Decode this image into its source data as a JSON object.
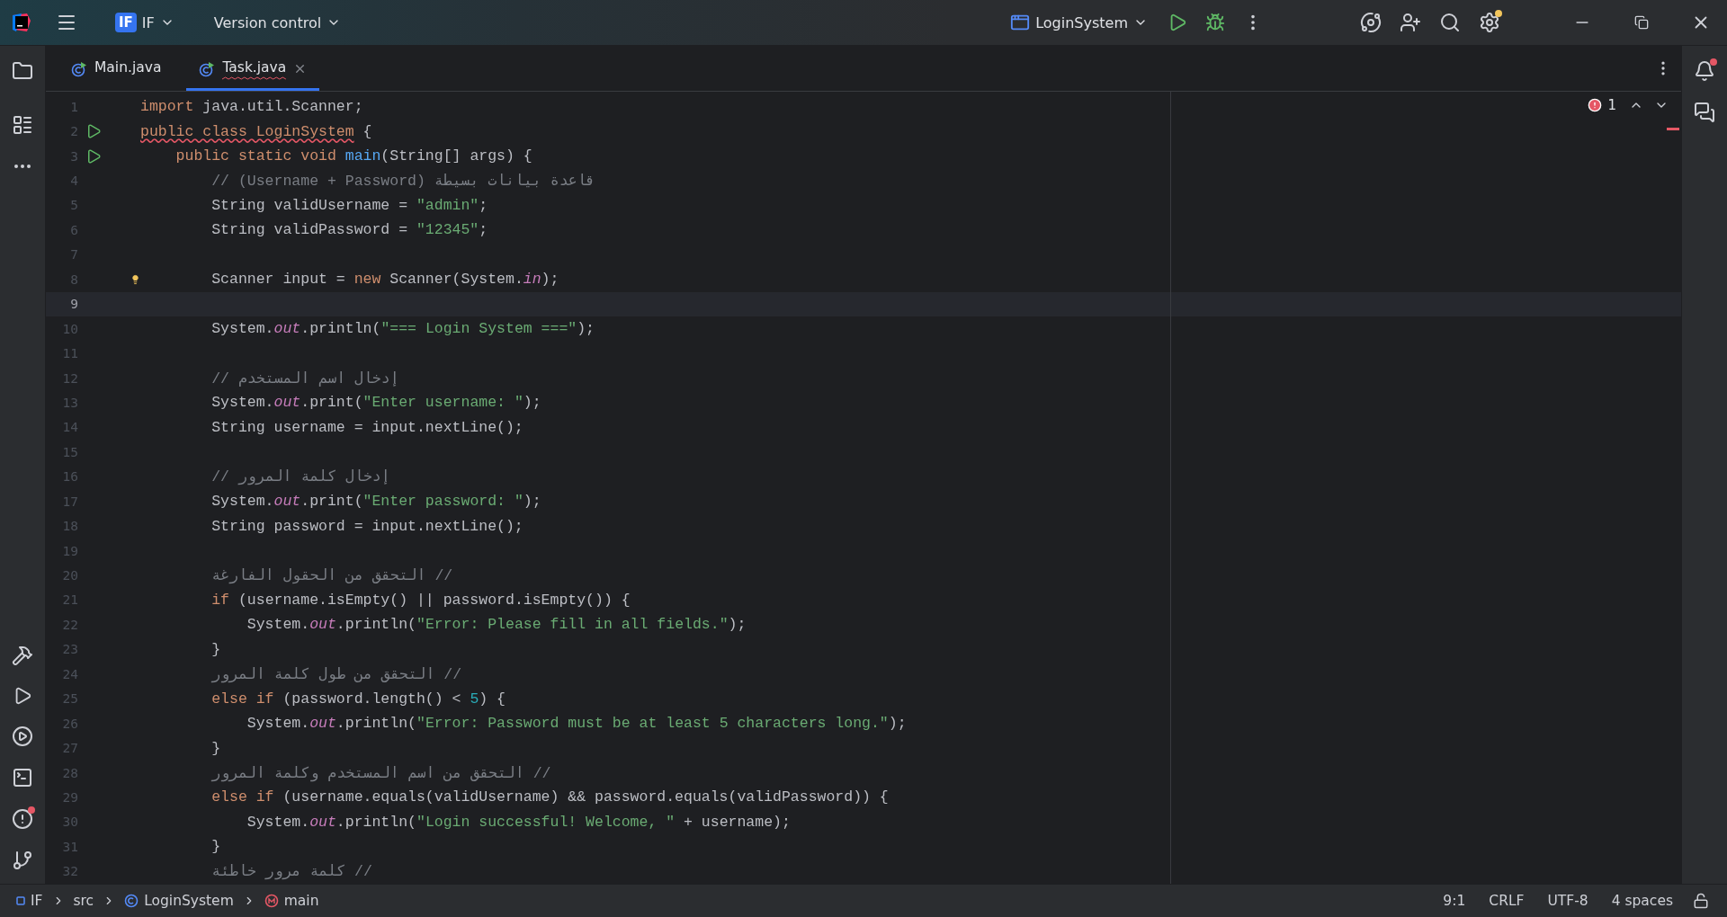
{
  "title_bar": {
    "project_badge": "IF",
    "project": "IF",
    "vcs": "Version control",
    "run_config": "LoginSystem"
  },
  "tabs": [
    {
      "label": "Main.java",
      "selected": false,
      "closable": false,
      "squiggle": false
    },
    {
      "label": "Task.java",
      "selected": true,
      "closable": true,
      "squiggle": true
    }
  ],
  "editor": {
    "problems": "1",
    "lines": [
      {
        "number": "1",
        "current": false,
        "kind": "plain",
        "tokens": [
          {
            "t": "import",
            "kind": "kw"
          },
          {
            "t": " java.util.Scanner;",
            "kind": "plain"
          }
        ]
      },
      {
        "number": "2",
        "current": false,
        "kind": "runnable",
        "tokens": [
          {
            "t": "public class LoginSystem",
            "kind": "kw_err"
          },
          {
            "t": " {",
            "kind": "plain"
          }
        ]
      },
      {
        "number": "3",
        "current": false,
        "kind": "runnable",
        "tokens": [
          {
            "t": "    public static void ",
            "kind": "kw"
          },
          {
            "t": "main",
            "kind": "fn"
          },
          {
            "t": "(String[] args) {",
            "kind": "plain"
          }
        ]
      },
      {
        "number": "4",
        "current": false,
        "kind": "plain",
        "tokens": [
          {
            "t": "        // (Username + Password) قاعدة بيانات بسيطة",
            "kind": "comment"
          }
        ]
      },
      {
        "number": "5",
        "current": false,
        "kind": "plain",
        "tokens": [
          {
            "t": "        String validUsername = ",
            "kind": "plain"
          },
          {
            "t": "\"admin\"",
            "kind": "str"
          },
          {
            "t": ";",
            "kind": "plain"
          }
        ]
      },
      {
        "number": "6",
        "current": false,
        "kind": "plain",
        "tokens": [
          {
            "t": "        String validPassword = ",
            "kind": "plain"
          },
          {
            "t": "\"12345\"",
            "kind": "str"
          },
          {
            "t": ";",
            "kind": "plain"
          }
        ]
      },
      {
        "number": "7",
        "current": false,
        "kind": "plain"
      },
      {
        "number": "8",
        "current": false,
        "kind": "hint",
        "tokens": [
          {
            "t": "        Scanner input = ",
            "kind": "plain"
          },
          {
            "t": "new",
            "kind": "kw"
          },
          {
            "t": " Scanner(System.",
            "kind": "plain"
          },
          {
            "t": "in",
            "kind": "field"
          },
          {
            "t": ");",
            "kind": "plain"
          }
        ]
      },
      {
        "number": "9",
        "current": true,
        "kind": "plain"
      },
      {
        "number": "10",
        "current": false,
        "kind": "plain",
        "tokens": [
          {
            "t": "        System.",
            "kind": "plain"
          },
          {
            "t": "out",
            "kind": "field"
          },
          {
            "t": ".println(",
            "kind": "plain"
          },
          {
            "t": "\"=== Login System ===\"",
            "kind": "str"
          },
          {
            "t": ");",
            "kind": "plain"
          }
        ]
      },
      {
        "number": "11",
        "current": false,
        "kind": "plain"
      },
      {
        "number": "12",
        "current": false,
        "kind": "plain",
        "tokens": [
          {
            "t": "        // إدخال اسم المستخدم",
            "kind": "comment"
          }
        ]
      },
      {
        "number": "13",
        "current": false,
        "kind": "plain",
        "tokens": [
          {
            "t": "        System.",
            "kind": "plain"
          },
          {
            "t": "out",
            "kind": "field"
          },
          {
            "t": ".print(",
            "kind": "plain"
          },
          {
            "t": "\"Enter username: \"",
            "kind": "str"
          },
          {
            "t": ");",
            "kind": "plain"
          }
        ]
      },
      {
        "number": "14",
        "current": false,
        "kind": "plain",
        "tokens": [
          {
            "t": "        String username = input.nextLine();",
            "kind": "plain"
          }
        ]
      },
      {
        "number": "15",
        "current": false,
        "kind": "plain"
      },
      {
        "number": "16",
        "current": false,
        "kind": "plain",
        "tokens": [
          {
            "t": "        // إدخال كلمة المرور",
            "kind": "comment"
          }
        ]
      },
      {
        "number": "17",
        "current": false,
        "kind": "plain",
        "tokens": [
          {
            "t": "        System.",
            "kind": "plain"
          },
          {
            "t": "out",
            "kind": "field"
          },
          {
            "t": ".print(",
            "kind": "plain"
          },
          {
            "t": "\"Enter password: \"",
            "kind": "str"
          },
          {
            "t": ");",
            "kind": "plain"
          }
        ]
      },
      {
        "number": "18",
        "current": false,
        "kind": "plain",
        "tokens": [
          {
            "t": "        String password = input.nextLine();",
            "kind": "plain"
          }
        ]
      },
      {
        "number": "19",
        "current": false,
        "kind": "plain"
      },
      {
        "number": "20",
        "current": false,
        "kind": "plain",
        "tokens": [
          {
            "t": "        التحقق من الحقول الفارغة //",
            "kind": "comment"
          }
        ]
      },
      {
        "number": "21",
        "current": false,
        "kind": "plain",
        "tokens": [
          {
            "t": "        if",
            "kind": "kw"
          },
          {
            "t": " (username.isEmpty() || password.isEmpty()) {",
            "kind": "plain"
          }
        ]
      },
      {
        "number": "22",
        "current": false,
        "kind": "plain",
        "tokens": [
          {
            "t": "            System.",
            "kind": "plain"
          },
          {
            "t": "out",
            "kind": "field"
          },
          {
            "t": ".println(",
            "kind": "plain"
          },
          {
            "t": "\"Error: Please fill in all fields.\"",
            "kind": "str"
          },
          {
            "t": ");",
            "kind": "plain"
          }
        ]
      },
      {
        "number": "23",
        "current": false,
        "kind": "plain",
        "tokens": [
          {
            "t": "        }",
            "kind": "plain"
          }
        ]
      },
      {
        "number": "24",
        "current": false,
        "kind": "plain",
        "tokens": [
          {
            "t": "        التحقق من طول كلمة المرور //",
            "kind": "comment"
          }
        ]
      },
      {
        "number": "25",
        "current": false,
        "kind": "plain",
        "tokens": [
          {
            "t": "        else if",
            "kind": "kw"
          },
          {
            "t": " (password.length() < ",
            "kind": "plain"
          },
          {
            "t": "5",
            "kind": "num"
          },
          {
            "t": ") {",
            "kind": "plain"
          }
        ]
      },
      {
        "number": "26",
        "current": false,
        "kind": "plain",
        "tokens": [
          {
            "t": "            System.",
            "kind": "plain"
          },
          {
            "t": "out",
            "kind": "field"
          },
          {
            "t": ".println(",
            "kind": "plain"
          },
          {
            "t": "\"Error: Password must be at least 5 characters long.\"",
            "kind": "str"
          },
          {
            "t": ");",
            "kind": "plain"
          }
        ]
      },
      {
        "number": "27",
        "current": false,
        "kind": "plain",
        "tokens": [
          {
            "t": "        }",
            "kind": "plain"
          }
        ]
      },
      {
        "number": "28",
        "current": false,
        "kind": "plain",
        "tokens": [
          {
            "t": "        التحقق من اسم المستخدم وكلمة المرور //",
            "kind": "comment"
          }
        ]
      },
      {
        "number": "29",
        "current": false,
        "kind": "plain",
        "tokens": [
          {
            "t": "        else if",
            "kind": "kw"
          },
          {
            "t": " (username.equals(validUsername) && password.equals(validPassword)) {",
            "kind": "plain"
          }
        ]
      },
      {
        "number": "30",
        "current": false,
        "kind": "plain",
        "tokens": [
          {
            "t": "            System.",
            "kind": "plain"
          },
          {
            "t": "out",
            "kind": "field"
          },
          {
            "t": ".println(",
            "kind": "plain"
          },
          {
            "t": "\"Login successful! Welcome, \"",
            "kind": "str"
          },
          {
            "t": " + username);",
            "kind": "plain"
          }
        ]
      },
      {
        "number": "31",
        "current": false,
        "kind": "plain",
        "tokens": [
          {
            "t": "        }",
            "kind": "plain"
          }
        ]
      },
      {
        "number": "32",
        "current": false,
        "kind": "plain",
        "tokens": [
          {
            "t": "        كلمة مرور خاطئة //",
            "kind": "comment"
          }
        ]
      }
    ]
  },
  "status_bar": {
    "breadcrumbs": [
      {
        "label": "IF",
        "kind": "module"
      },
      {
        "label": "src",
        "kind": "folder"
      },
      {
        "label": "LoginSystem",
        "kind": "class"
      },
      {
        "label": "main",
        "kind": "method"
      }
    ],
    "position": "9:1",
    "line_separator": "CRLF",
    "encoding": "UTF-8",
    "indent": "4 spaces"
  }
}
